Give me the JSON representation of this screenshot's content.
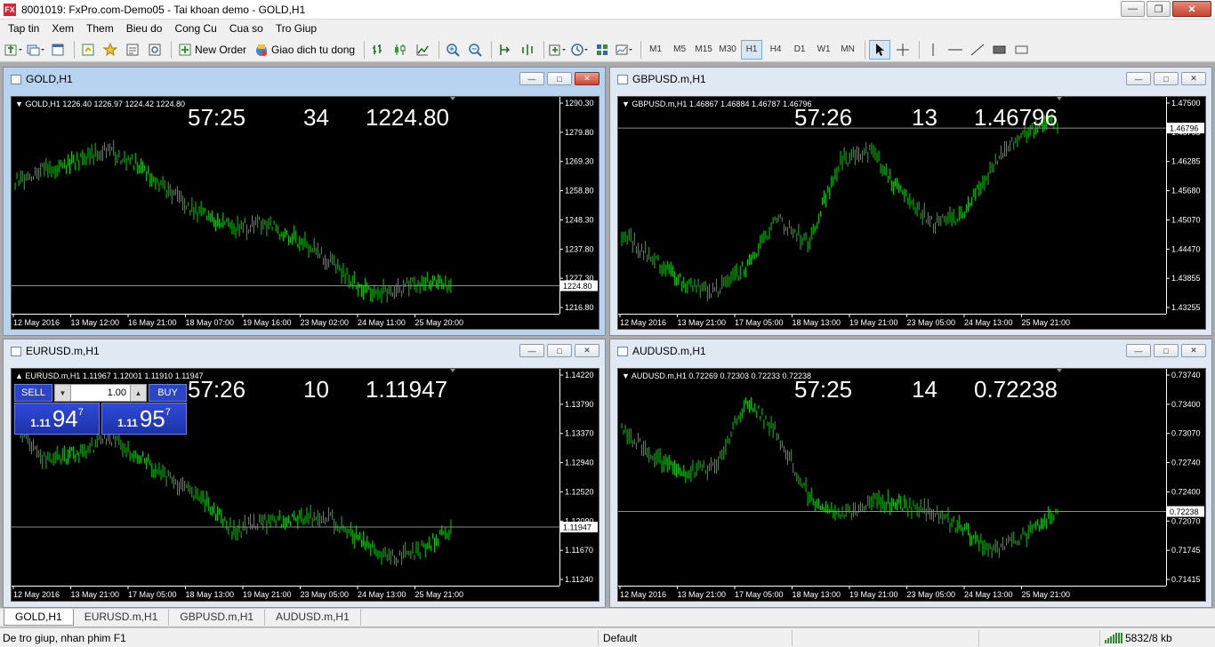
{
  "window": {
    "title": "8001019: FxPro.com-Demo05 - Tai khoan demo - GOLD,H1",
    "app_icon": "FX"
  },
  "menu": [
    "Tap tin",
    "Xem",
    "Them",
    "Bieu do",
    "Cong Cu",
    "Cua so",
    "Tro Giup"
  ],
  "toolbar": {
    "new_order": "New Order",
    "auto_trading": "Giao dich tu dong",
    "timeframes": [
      "M1",
      "M5",
      "M15",
      "M30",
      "H1",
      "H4",
      "D1",
      "W1",
      "MN"
    ],
    "active_timeframe": "H1"
  },
  "charts": [
    {
      "window_title": "GOLD,H1",
      "info": "GOLD,H1  1226.40 1226.97 1224.42 1224.80",
      "timer": "57:25",
      "spread": "34",
      "last_price": "1224.80",
      "price_label": "1224.80",
      "yticks": [
        "1290.30",
        "1279.80",
        "1269.30",
        "1258.80",
        "1248.30",
        "1237.80",
        "1227.30",
        "1216.80"
      ],
      "xticks": [
        "12 May 2016",
        "13 May 12:00",
        "16 May 21:00",
        "18 May 07:00",
        "19 May 16:00",
        "23 May 02:00",
        "24 May 11:00",
        "25 May 20:00"
      ],
      "active": true,
      "seed": 11,
      "trend": [
        0.62,
        0.68,
        0.72,
        0.78,
        0.7,
        0.55,
        0.45,
        0.38,
        0.4,
        0.32,
        0.22,
        0.08,
        0.04,
        0.1,
        0.08
      ]
    },
    {
      "window_title": "GBPUSD.m,H1",
      "info": "GBPUSD.m,H1  1.46867 1.46884 1.46787 1.46796",
      "timer": "57:26",
      "spread": "13",
      "last_price": "1.46796",
      "price_label": "1.46796",
      "yticks": [
        "1.47500",
        "1.46795",
        "1.46285",
        "1.45680",
        "1.45070",
        "1.44470",
        "1.43855",
        "1.43255"
      ],
      "xticks": [
        "12 May 2016",
        "13 May 21:00",
        "17 May 05:00",
        "18 May 13:00",
        "19 May 21:00",
        "23 May 05:00",
        "24 May 13:00",
        "25 May 21:00"
      ],
      "active": false,
      "seed": 23,
      "trend": [
        0.35,
        0.22,
        0.1,
        0.05,
        0.18,
        0.42,
        0.3,
        0.72,
        0.78,
        0.55,
        0.4,
        0.45,
        0.72,
        0.88,
        0.92
      ]
    },
    {
      "window_title": "EURUSD.m,H1",
      "info": "EURUSD.m,H1  1.11967 1.12001 1.11910 1.11947",
      "timer": "57:26",
      "spread": "10",
      "last_price": "1.11947",
      "price_label": "1.11947",
      "yticks": [
        "1.14220",
        "1.13790",
        "1.13370",
        "1.12940",
        "1.12520",
        "1.12090",
        "1.11670",
        "1.11240"
      ],
      "xticks": [
        "12 May 2016",
        "13 May 21:00",
        "17 May 05:00",
        "18 May 13:00",
        "19 May 21:00",
        "23 May 05:00",
        "24 May 13:00",
        "25 May 21:00"
      ],
      "active": false,
      "seed": 37,
      "trend": [
        0.78,
        0.58,
        0.62,
        0.7,
        0.6,
        0.48,
        0.38,
        0.22,
        0.26,
        0.28,
        0.3,
        0.18,
        0.08,
        0.12,
        0.22
      ],
      "trade_panel": {
        "sell": "SELL",
        "buy": "BUY",
        "lot": "1.00",
        "bid_small": "1.11",
        "bid_big": "94",
        "bid_exp": "7",
        "ask_small": "1.11",
        "ask_big": "95",
        "ask_exp": "7"
      }
    },
    {
      "window_title": "AUDUSD.m,H1",
      "info": "AUDUSD.m,H1  0.72269 0.72303 0.72233 0.72238",
      "timer": "57:25",
      "spread": "14",
      "last_price": "0.72238",
      "price_label": "0.72238",
      "yticks": [
        "0.73740",
        "0.73400",
        "0.73070",
        "0.72740",
        "0.72400",
        "0.72070",
        "0.71745",
        "0.71415"
      ],
      "xticks": [
        "12 May 2016",
        "13 May 21:00",
        "17 May 05:00",
        "18 May 13:00",
        "19 May 21:00",
        "23 May 05:00",
        "24 May 13:00",
        "25 May 21:00"
      ],
      "active": false,
      "seed": 51,
      "trend": [
        0.75,
        0.6,
        0.52,
        0.55,
        0.9,
        0.72,
        0.4,
        0.28,
        0.38,
        0.35,
        0.32,
        0.22,
        0.12,
        0.2,
        0.32
      ]
    }
  ],
  "tabs": [
    "GOLD,H1",
    "EURUSD.m,H1",
    "GBPUSD.m,H1",
    "AUDUSD.m,H1"
  ],
  "active_tab": "GOLD,H1",
  "status": {
    "help": "De tro giup, nhan phim F1",
    "profile": "Default",
    "traffic": "5832/8 kb"
  },
  "colors": {
    "candle": "#00d000",
    "grid_line": "#8c8c8c",
    "background": "#000000",
    "text": "#ffffff"
  }
}
